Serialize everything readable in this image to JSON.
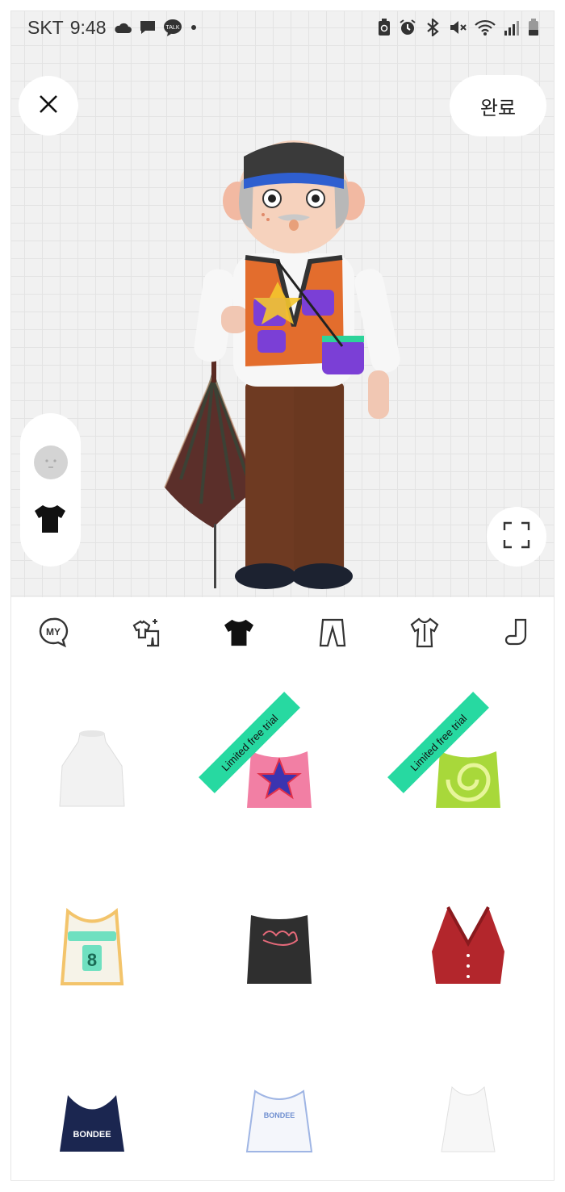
{
  "status_bar": {
    "carrier": "SKT",
    "time": "9:48",
    "left_icons": [
      "cloud-icon",
      "chat-bubble-icon",
      "kakaotalk-icon",
      "dot-icon"
    ],
    "kakaotalk_label": "TALK",
    "right_icons": [
      "recycle-battery-icon",
      "alarm-icon",
      "bluetooth-icon",
      "mute-icon",
      "wifi-icon",
      "signal-icon",
      "battery-icon"
    ]
  },
  "header": {
    "close_icon": "close-icon",
    "done_label": "완료"
  },
  "side_panel": {
    "items": [
      "face-icon",
      "tshirt-icon"
    ]
  },
  "tabs": {
    "items": [
      {
        "name": "my",
        "icon": "my-icon",
        "label": "MY"
      },
      {
        "name": "outfit",
        "icon": "outfit-icon"
      },
      {
        "name": "tops",
        "icon": "tshirt-icon",
        "active": true
      },
      {
        "name": "bottoms",
        "icon": "pants-icon"
      },
      {
        "name": "outerwear",
        "icon": "onepiece-icon"
      },
      {
        "name": "socks",
        "icon": "sock-icon"
      }
    ]
  },
  "items": [
    {
      "name": "white-halter-top",
      "color": "#f2f2f2",
      "badge": ""
    },
    {
      "name": "pink-star-tank",
      "color": "#f27fa4",
      "badge": "Limited free trial"
    },
    {
      "name": "green-tiedye-tank",
      "color": "#a8d83a",
      "badge": "Limited free trial"
    },
    {
      "name": "basketball-jersey",
      "color": "#f6f3e8",
      "badge": "",
      "text": "8"
    },
    {
      "name": "black-crop-tank",
      "color": "#2f2f2f",
      "badge": ""
    },
    {
      "name": "red-halter-vest",
      "color": "#b3262c",
      "badge": ""
    },
    {
      "name": "navy-sports-bra",
      "color": "#1b2650",
      "badge": "",
      "text": "BONDEE"
    },
    {
      "name": "white-crop-tank",
      "color": "#f4f6fb",
      "badge": "",
      "text": "BONDEE"
    },
    {
      "name": "white-tank",
      "color": "#f7f7f7",
      "badge": ""
    }
  ],
  "colors": {
    "ribbon": "#27d9a1",
    "accent": "#111111"
  }
}
